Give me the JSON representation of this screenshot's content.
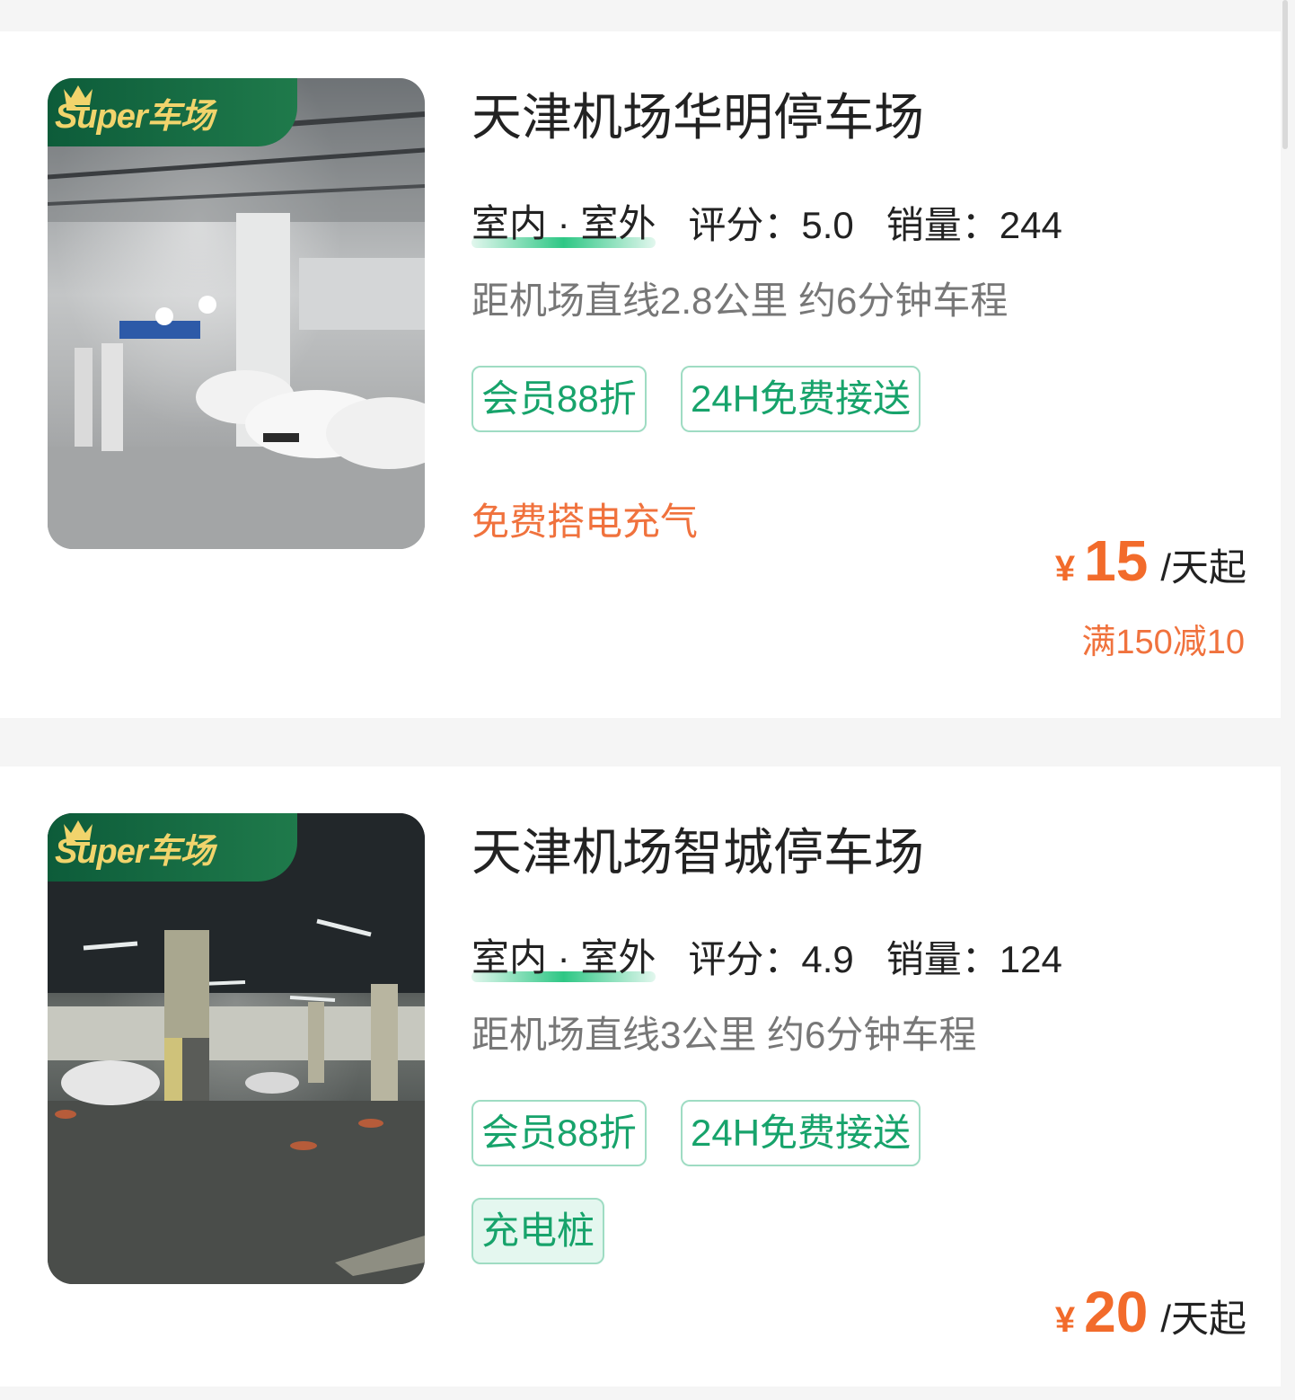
{
  "listings": [
    {
      "badge": "Super车场",
      "title": "天津机场华明停车场",
      "type": "室内 · 室外",
      "rating_label": "评分：",
      "rating": "5.0",
      "sales_label": "销量：",
      "sales": "244",
      "distance": "距机场直线2.8公里 约6分钟车程",
      "tags": [
        "会员88折",
        "24H免费接送"
      ],
      "promo": "免费搭电充气",
      "price_symbol": "¥",
      "price": "15",
      "price_unit": "/天起",
      "discount": "满150减10"
    },
    {
      "badge": "Super车场",
      "title": "天津机场智城停车场",
      "type": "室内 · 室外",
      "rating_label": "评分：",
      "rating": "4.9",
      "sales_label": "销量：",
      "sales": "124",
      "distance": "距机场直线3公里 约6分钟车程",
      "tags": [
        "会员88折",
        "24H免费接送"
      ],
      "feature_tag": "充电桩",
      "price_symbol": "¥",
      "price": "20",
      "price_unit": "/天起"
    }
  ],
  "colors": {
    "accent_green": "#17a36b",
    "price_orange": "#f26b2b",
    "promo_orange": "#f0723d",
    "badge_green": "#0d5c3a",
    "badge_gold": "#f1d46c"
  },
  "icons": [
    "crown-icon"
  ]
}
